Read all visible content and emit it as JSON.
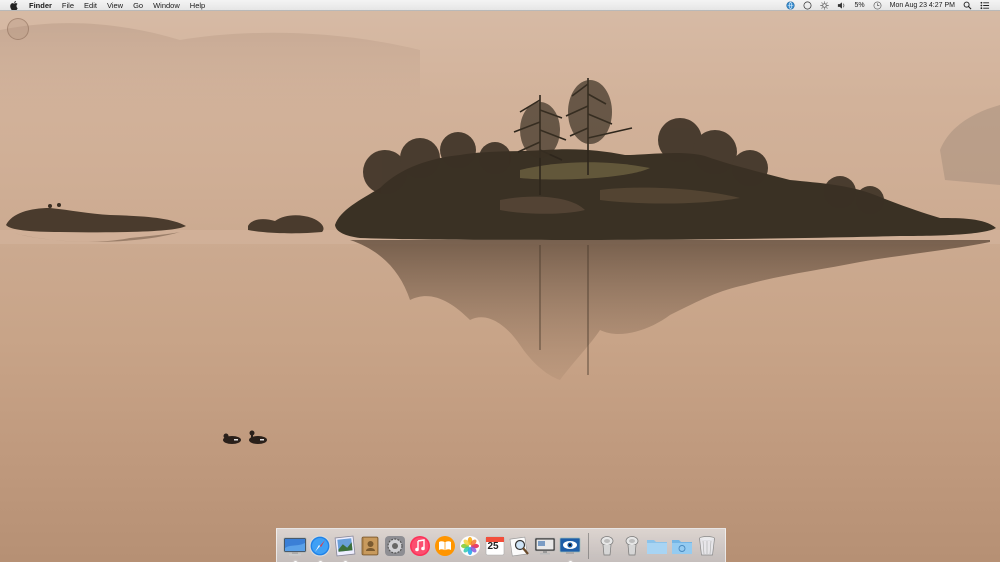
{
  "menubar": {
    "apple_icon": "apple-logo-icon",
    "app_name": "Finder",
    "menus": [
      "File",
      "Edit",
      "View",
      "Go",
      "Window",
      "Help"
    ],
    "status": {
      "battery_percent": "5%",
      "clock": "Mon Aug 23  4:27 PM",
      "icons": [
        "sync-globe-icon",
        "circle-status-icon",
        "brightness-sun-icon",
        "volume-icon",
        "clock-status-icon",
        "spotlight-search-icon",
        "notification-list-icon"
      ]
    }
  },
  "dock": {
    "items": [
      {
        "name": "dock-finder-display",
        "icon": "monitor-icon",
        "running": true
      },
      {
        "name": "dock-safari",
        "icon": "compass-icon",
        "running": true
      },
      {
        "name": "dock-preview",
        "icon": "preview-icon",
        "running": true
      },
      {
        "name": "dock-contacts",
        "icon": "contacts-book-icon",
        "running": false
      },
      {
        "name": "dock-system-preferences",
        "icon": "gear-icon",
        "running": false
      },
      {
        "name": "dock-itunes",
        "icon": "music-note-icon",
        "running": false
      },
      {
        "name": "dock-ibooks",
        "icon": "book-icon",
        "running": false
      },
      {
        "name": "dock-photos",
        "icon": "photos-flower-icon",
        "running": false
      },
      {
        "name": "dock-calendar",
        "icon": "calendar-icon",
        "running": false
      },
      {
        "name": "dock-preview-magnifier",
        "icon": "magnifier-photo-icon",
        "running": false
      },
      {
        "name": "dock-remote-desktop",
        "icon": "screen-share-icon",
        "running": false
      },
      {
        "name": "dock-screenshot-app",
        "icon": "eye-screen-icon",
        "running": true
      },
      {
        "name": "dock-downloads-stack",
        "icon": "stack-icon",
        "running": false
      },
      {
        "name": "dock-documents-stack",
        "icon": "stack-icon",
        "running": false
      },
      {
        "name": "dock-folder",
        "icon": "folder-icon",
        "running": false
      },
      {
        "name": "dock-folder-2",
        "icon": "folder-icon",
        "running": false
      },
      {
        "name": "dock-trash",
        "icon": "trash-icon",
        "running": false
      }
    ],
    "calendar_day": "25"
  },
  "colors": {
    "menubar_bg": "#ececec",
    "wallpaper_sky": "#d7bba6",
    "wallpaper_water": "#c8a488",
    "island_dark": "#3a3124"
  }
}
